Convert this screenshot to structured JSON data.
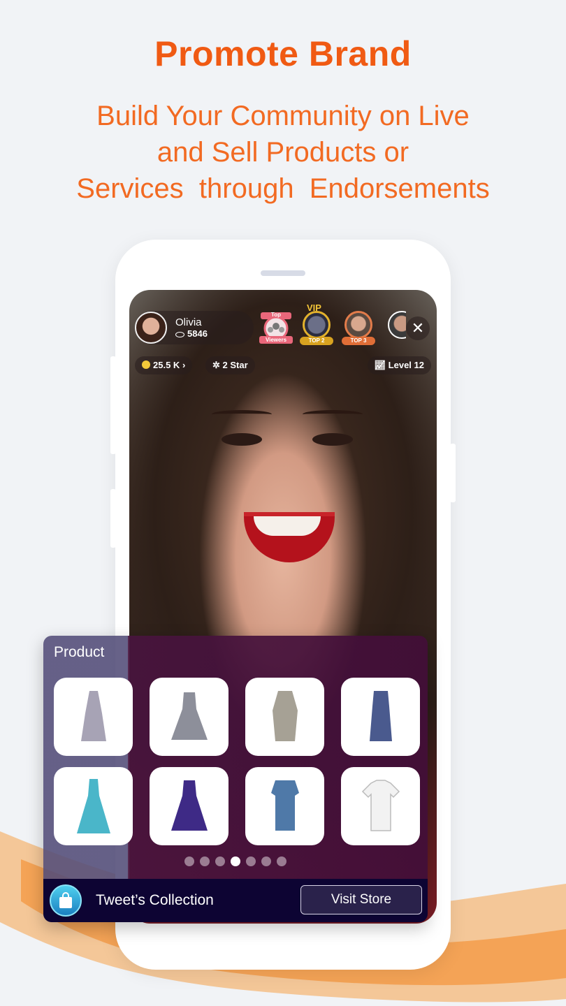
{
  "headline": "Promote Brand",
  "subtitle_lines": [
    "Build Your Community on Live",
    "and Sell Products or",
    "Services  through  Endorsements"
  ],
  "stream": {
    "host_name": "Olivia",
    "viewers": "5846",
    "coins": "25.5 K",
    "stars": "2 Star",
    "level": "Level 12",
    "top_viewers_label_top": "Top",
    "top_viewers_label_bottom": "Viewers",
    "vip_label": "VIP",
    "rank_labels": [
      "TOP 2",
      "TOP 3"
    ]
  },
  "product_panel": {
    "title": "Product",
    "products": [
      {
        "icon": "halter-dress-icon",
        "color": "#a7a3b5"
      },
      {
        "icon": "gingham-dress-icon",
        "color": "#8d8f9a"
      },
      {
        "icon": "trench-dress-icon",
        "color": "#a6a195"
      },
      {
        "icon": "polka-dress-icon",
        "color": "#4a5a8e"
      },
      {
        "icon": "gown-dress-icon",
        "color": "#4ab6c9"
      },
      {
        "icon": "lace-dress-icon",
        "color": "#3e2a86"
      },
      {
        "icon": "denim-dress-icon",
        "color": "#4f79a8"
      },
      {
        "icon": "tshirt-icon",
        "color": "#f2f2f2"
      }
    ],
    "page_count": 7,
    "active_page": 4,
    "store_name": "Tweet’s Collection",
    "visit_label": "Visit Store"
  },
  "colors": {
    "brand_orange": "#f05a13",
    "panel_bar": "#0d0433"
  }
}
